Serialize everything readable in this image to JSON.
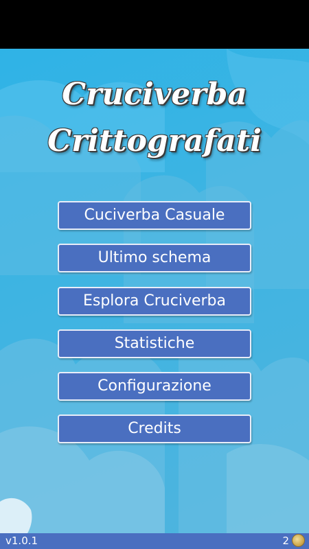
{
  "app": {
    "title_line1": "Cruciverba",
    "title_line2": "Crittografati"
  },
  "menu": {
    "items": [
      {
        "label": "Cuciverba Casuale"
      },
      {
        "label": "Ultimo schema"
      },
      {
        "label": "Esplora Cruciverba"
      },
      {
        "label": "Statistiche"
      },
      {
        "label": "Configurazione"
      },
      {
        "label": "Credits"
      }
    ]
  },
  "footer": {
    "version": "v1.0.1",
    "coins": "2",
    "coin_icon": "coin-icon"
  },
  "colors": {
    "button_bg": "#4a6fc0",
    "sky": "#3fb4e2",
    "footer_bg": "#4a6fc0"
  }
}
